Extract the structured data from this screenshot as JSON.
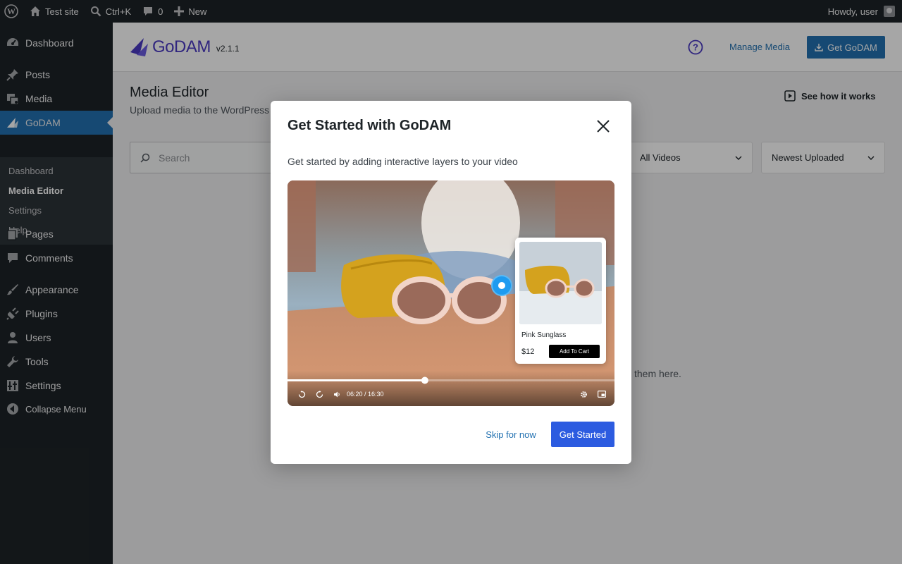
{
  "adminbar": {
    "site_name": "Test site",
    "shortcut": "Ctrl+K",
    "comments_count": "0",
    "new_label": "New",
    "howdy": "Howdy, user"
  },
  "sidebar": {
    "items": [
      {
        "label": "Dashboard",
        "icon": "dashboard-icon"
      },
      {
        "label": "Posts",
        "icon": "pin-icon"
      },
      {
        "label": "Media",
        "icon": "media-icon"
      },
      {
        "label": "GoDAM",
        "icon": "godam-icon"
      },
      {
        "label": "Pages",
        "icon": "pages-icon"
      },
      {
        "label": "Comments",
        "icon": "comment-icon"
      },
      {
        "label": "Appearance",
        "icon": "brush-icon"
      },
      {
        "label": "Plugins",
        "icon": "plugin-icon"
      },
      {
        "label": "Users",
        "icon": "user-icon"
      },
      {
        "label": "Tools",
        "icon": "wrench-icon"
      },
      {
        "label": "Settings",
        "icon": "settings-icon"
      },
      {
        "label": "Collapse Menu",
        "icon": "collapse-icon"
      }
    ],
    "submenu": [
      "Dashboard",
      "Media Editor",
      "Settings",
      "Help"
    ],
    "active_item": "GoDAM",
    "current_sub": "Media Editor"
  },
  "header": {
    "logo_text": "GoDAM",
    "version": "v2.1.1",
    "manage_media": "Manage Media",
    "get_godam": "Get GoDAM"
  },
  "page": {
    "title": "Media Editor",
    "subtitle": "Upload media to the WordPress",
    "see_how": "See how it works",
    "search_placeholder": "Search",
    "filter_type": "All Videos",
    "sort": "Newest Uploaded",
    "empty_message": "them here."
  },
  "modal": {
    "title": "Get Started with GoDAM",
    "description": "Get started by adding interactive layers to your video",
    "product_name": "Pink Sunglass",
    "product_price": "$12",
    "add_to_cart": "Add To Cart",
    "time_display": "06:20 / 16:30",
    "progress": 0.42,
    "skip_label": "Skip for now",
    "start_label": "Get Started"
  },
  "colors": {
    "wp_dark": "#1d2327",
    "wp_blue": "#2271b1",
    "godam_purple": "#4a3ac4",
    "cta_blue": "#2c5be0"
  }
}
